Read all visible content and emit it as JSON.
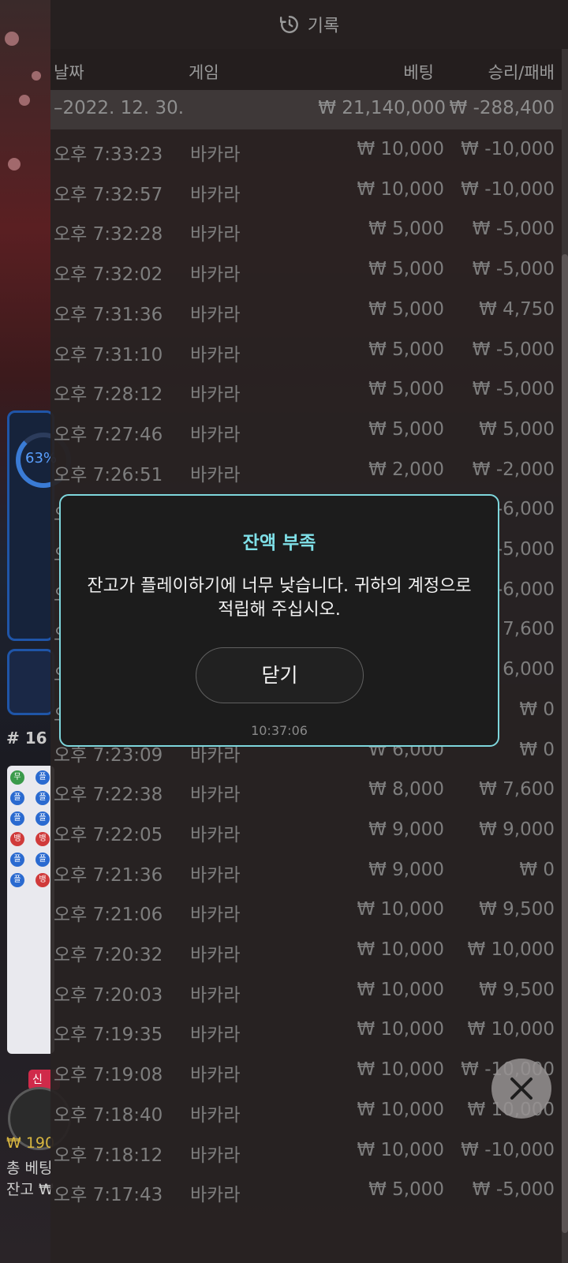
{
  "header": {
    "title": "기록",
    "icon": "history-icon"
  },
  "columns": {
    "date": "날짜",
    "game": "게임",
    "bet": "베팅",
    "win_loss": "승리/패배"
  },
  "date_group": {
    "date": "–2022. 12. 30.",
    "total_bet": "₩ 21,140,000",
    "total_win_loss": "₩ -288,400"
  },
  "rows": [
    {
      "time": "오후 7:33:23",
      "game": "바카라",
      "bet": "₩ 10,000",
      "result": "₩ -10,000"
    },
    {
      "time": "오후 7:32:57",
      "game": "바카라",
      "bet": "₩ 10,000",
      "result": "₩ -10,000"
    },
    {
      "time": "오후 7:32:28",
      "game": "바카라",
      "bet": "₩ 5,000",
      "result": "₩ -5,000"
    },
    {
      "time": "오후 7:32:02",
      "game": "바카라",
      "bet": "₩ 5,000",
      "result": "₩ -5,000"
    },
    {
      "time": "오후 7:31:36",
      "game": "바카라",
      "bet": "₩ 5,000",
      "result": "₩ 4,750"
    },
    {
      "time": "오후 7:31:10",
      "game": "바카라",
      "bet": "₩ 5,000",
      "result": "₩ -5,000"
    },
    {
      "time": "오후 7:28:12",
      "game": "바카라",
      "bet": "₩ 5,000",
      "result": "₩ -5,000"
    },
    {
      "time": "오후 7:27:46",
      "game": "바카라",
      "bet": "₩ 5,000",
      "result": "₩ 5,000"
    },
    {
      "time": "오후 7:26:51",
      "game": "바카라",
      "bet": "₩ 2,000",
      "result": "₩ -2,000"
    },
    {
      "time": "오후",
      "game": "",
      "bet": "",
      "result": "₩ -6,000"
    },
    {
      "time": "오후",
      "game": "",
      "bet": "",
      "result": "₩ -5,000"
    },
    {
      "time": "오후",
      "game": "",
      "bet": "",
      "result": "₩ -6,000"
    },
    {
      "time": "오후",
      "game": "",
      "bet": "",
      "result": "₩ 7,600"
    },
    {
      "time": "오후",
      "game": "",
      "bet": "",
      "result": "₩ 6,000"
    },
    {
      "time": "오후",
      "game": "",
      "bet": "",
      "result": "₩ 0"
    },
    {
      "time": "오후 7:23:09",
      "game": "바카라",
      "bet": "₩ 6,000",
      "result": "₩ 0"
    },
    {
      "time": "오후 7:22:38",
      "game": "바카라",
      "bet": "₩ 8,000",
      "result": "₩ 7,600"
    },
    {
      "time": "오후 7:22:05",
      "game": "바카라",
      "bet": "₩ 9,000",
      "result": "₩ 9,000"
    },
    {
      "time": "오후 7:21:36",
      "game": "바카라",
      "bet": "₩ 9,000",
      "result": "₩ 0"
    },
    {
      "time": "오후 7:21:06",
      "game": "바카라",
      "bet": "₩ 10,000",
      "result": "₩ 9,500"
    },
    {
      "time": "오후 7:20:32",
      "game": "바카라",
      "bet": "₩ 10,000",
      "result": "₩ 10,000"
    },
    {
      "time": "오후 7:20:03",
      "game": "바카라",
      "bet": "₩ 10,000",
      "result": "₩ 9,500"
    },
    {
      "time": "오후 7:19:35",
      "game": "바카라",
      "bet": "₩ 10,000",
      "result": "₩ 10,000"
    },
    {
      "time": "오후 7:19:08",
      "game": "바카라",
      "bet": "₩ 10,000",
      "result": "₩ -10,000"
    },
    {
      "time": "오후 7:18:40",
      "game": "바카라",
      "bet": "₩ 10,000",
      "result": "₩ 10,000"
    },
    {
      "time": "오후 7:18:12",
      "game": "바카라",
      "bet": "₩ 10,000",
      "result": "₩ -10,000"
    },
    {
      "time": "오후 7:17:43",
      "game": "바카라",
      "bet": "₩ 5,000",
      "result": "₩ -5,000"
    }
  ],
  "modal": {
    "title": "잔액 부족",
    "message": "잔고가 플레이하기에 너무 낮습니다. 귀하의 계정으로 적립해 주십시오.",
    "button": "닫기",
    "timestamp": "10:37:06"
  },
  "background": {
    "percent": "63%",
    "table_number": "# 16",
    "new_badge": "신",
    "balance_amount": "₩ 190",
    "total_bet_label": "총 베팅",
    "balance_label": "잔고 ₩"
  },
  "close_button": {
    "icon": "close-icon"
  },
  "colors": {
    "accent": "#7fe0e8",
    "modal_border": "#7ed6dc",
    "panel": "#282222"
  }
}
